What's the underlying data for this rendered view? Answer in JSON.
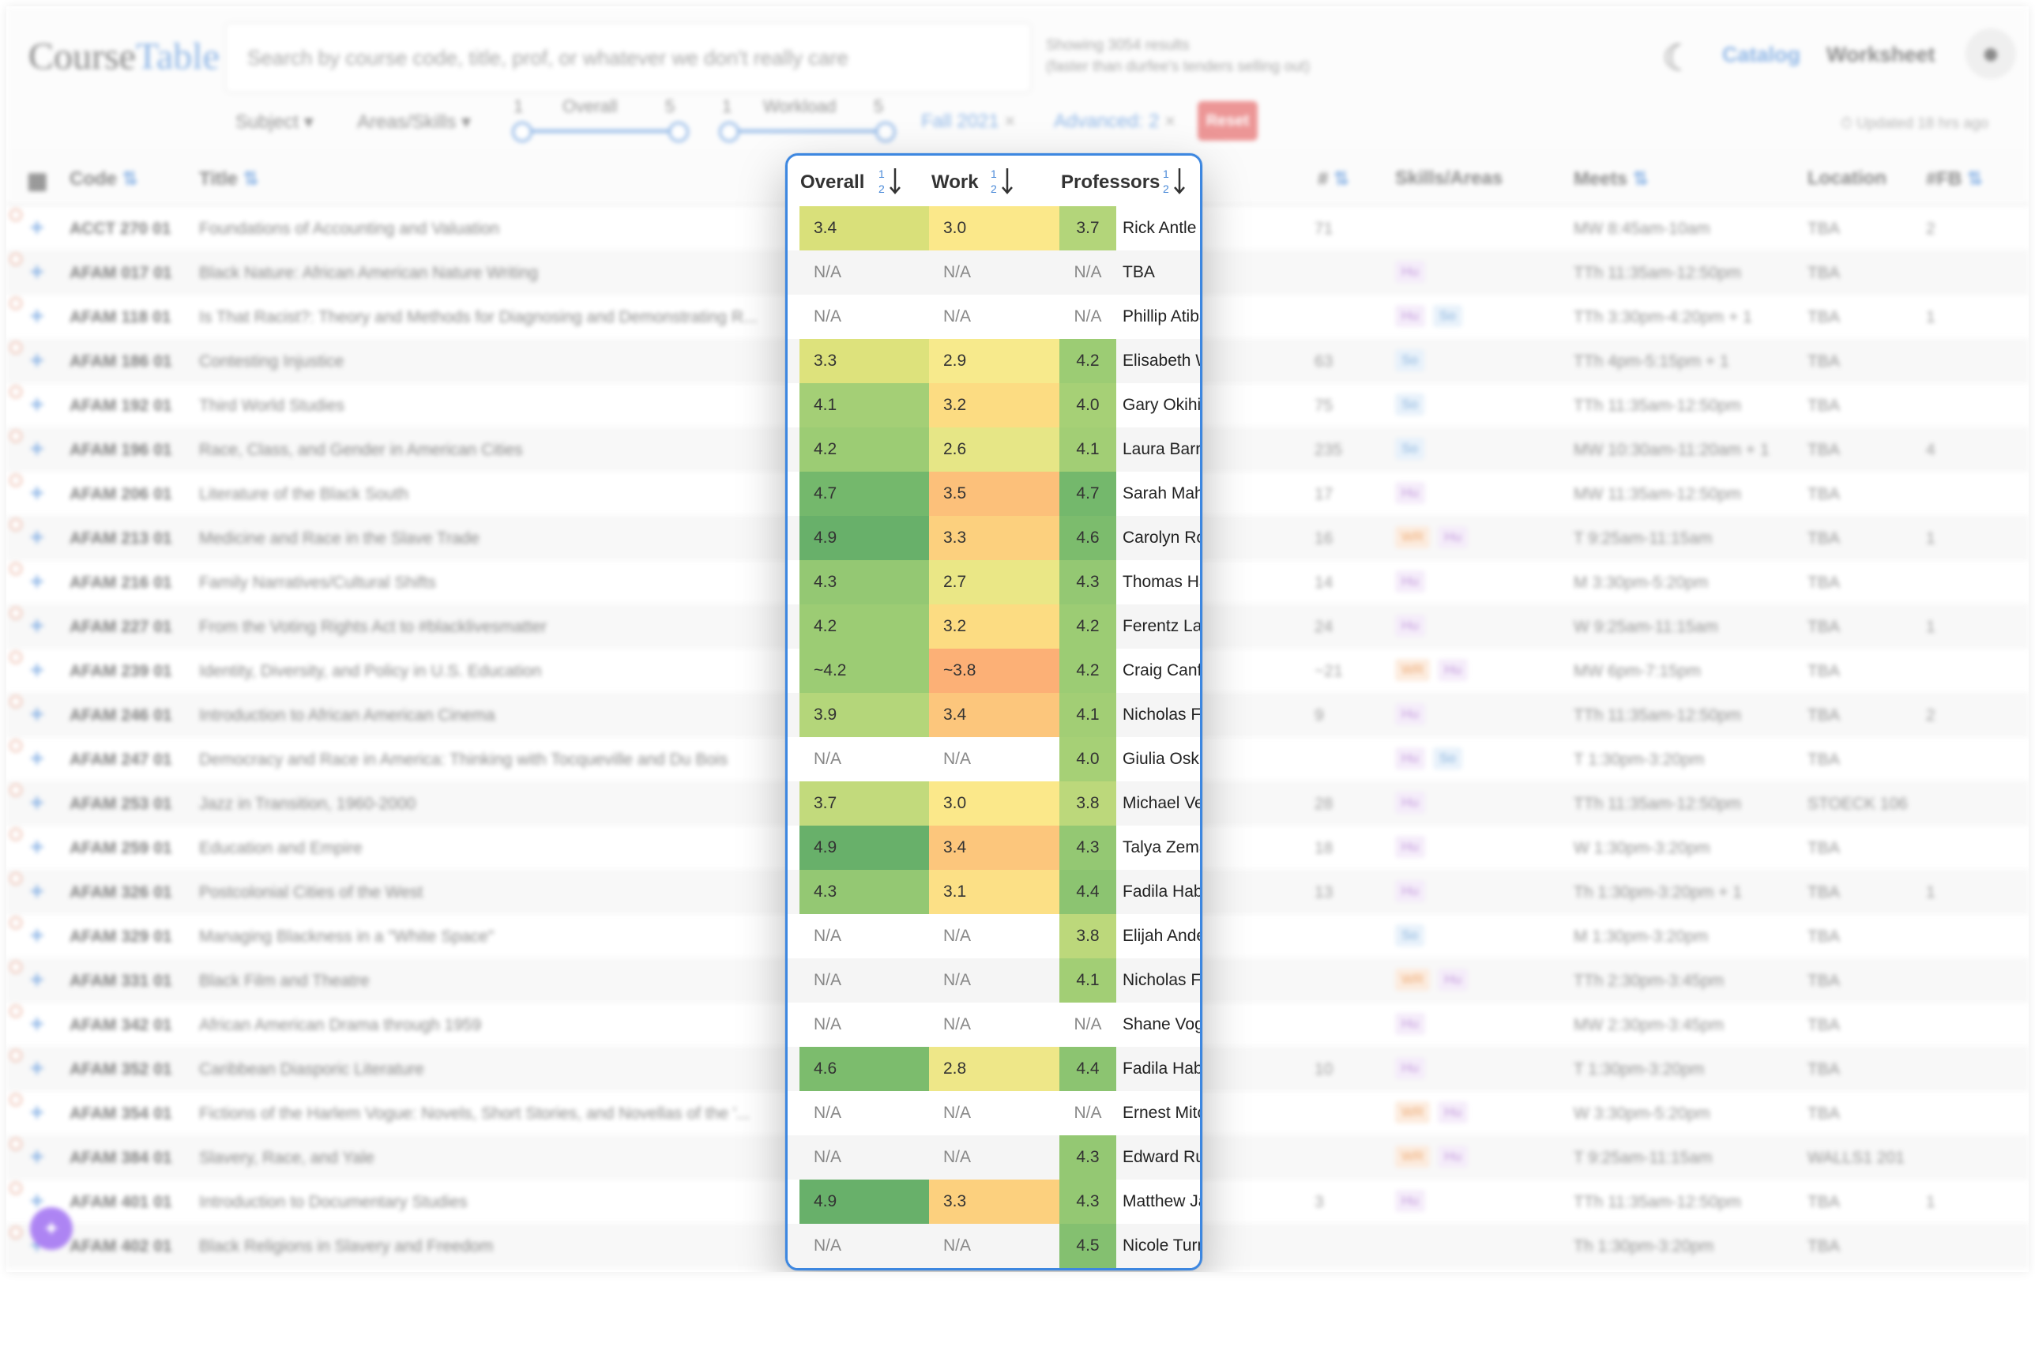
{
  "app": {
    "logo_part1": "Course",
    "logo_part2": "Table",
    "search_placeholder": "Search by course code, title, prof, or whatever we don't really care",
    "results_line1": "Showing 3054 results",
    "results_line2": "(faster than durfee's tenders selling out)",
    "nav_catalog": "Catalog",
    "nav_worksheet": "Worksheet",
    "updated": "Updated 18 hrs ago",
    "colors": {
      "accent": "#4a8ad8",
      "reset": "#e25757",
      "highlight_border": "#3d87e0"
    }
  },
  "filters": {
    "subject": "Subject",
    "areas": "Areas/Skills",
    "overall_label": "Overall",
    "workload_label": "Workload",
    "slider_min": "1",
    "slider_max": "5",
    "chip_term": "Fall 2021",
    "chip_advanced": "Advanced: 2",
    "chip_remove": "×",
    "reset": "Reset"
  },
  "columns": {
    "code": "Code",
    "title": "Title",
    "overall": "Overall",
    "work": "Work",
    "professors": "Professors",
    "enrollment": "#",
    "skills": "Skills/Areas",
    "meets": "Meets",
    "location": "Location",
    "fb": "#FB"
  },
  "rows": [
    {
      "code": "ACCT 270 01",
      "title": "Foundations of Accounting and Valuation",
      "overall": "3.4",
      "work": "3.0",
      "prof_rating": "3.7",
      "prof": "Rick Antle",
      "enroll": "71",
      "tags": [],
      "meets": "MW 8:45am-10am",
      "loc": "TBA",
      "fb": "2",
      "oc": "#d9e07a",
      "wc": "#fbe88a",
      "pc": "#b3d57a"
    },
    {
      "code": "AFAM 017 01",
      "title": "Black Nature: African American Nature Writing",
      "overall": "N/A",
      "work": "N/A",
      "prof_rating": "N/A",
      "prof": "TBA",
      "enroll": "",
      "tags": [
        "Hu"
      ],
      "meets": "TTh 11:35am-12:50pm",
      "loc": "TBA",
      "fb": "",
      "oc": "",
      "wc": "",
      "pc": ""
    },
    {
      "code": "AFAM 118 01",
      "title": "Is That Racist?: Theory and Methods for Diagnosing and Demonstrating R...",
      "overall": "N/A",
      "work": "N/A",
      "prof_rating": "N/A",
      "prof": "Phillip Atiba Goff",
      "enroll": "",
      "tags": [
        "Hu",
        "So"
      ],
      "meets": "TTh 3:30pm-4:20pm + 1",
      "loc": "TBA",
      "fb": "1",
      "oc": "",
      "wc": "",
      "pc": ""
    },
    {
      "code": "AFAM 186 01",
      "title": "Contesting Injustice",
      "overall": "3.3",
      "work": "2.9",
      "prof_rating": "4.2",
      "prof": "Elisabeth Wood",
      "enroll": "63",
      "tags": [
        "So"
      ],
      "meets": "TTh 4pm-5:15pm + 1",
      "loc": "TBA",
      "fb": "",
      "oc": "#dde27c",
      "wc": "#f7ea8c",
      "pc": "#9ccc74"
    },
    {
      "code": "AFAM 192 01",
      "title": "Third World Studies",
      "overall": "4.1",
      "work": "3.2",
      "prof_rating": "4.0",
      "prof": "Gary Okihiro",
      "enroll": "75",
      "tags": [
        "So"
      ],
      "meets": "TTh 11:35am-12:50pm",
      "loc": "TBA",
      "fb": "",
      "oc": "#a4cf76",
      "wc": "#fcdc82",
      "pc": "#a6d076"
    },
    {
      "code": "AFAM 196 01",
      "title": "Race, Class, and Gender in American Cities",
      "overall": "4.2",
      "work": "2.6",
      "prof_rating": "4.1",
      "prof": "Laura Barraclough",
      "enroll": "235",
      "tags": [
        "So"
      ],
      "meets": "MW 10:30am-11:20am + 1",
      "loc": "TBA",
      "fb": "4",
      "oc": "#9ccc74",
      "wc": "#e6e686",
      "pc": "#a2ce75"
    },
    {
      "code": "AFAM 206 01",
      "title": "Literature of the Black South",
      "overall": "4.7",
      "work": "3.5",
      "prof_rating": "4.7",
      "prof": "Sarah Mahurin",
      "enroll": "17",
      "tags": [
        "Hu"
      ],
      "meets": "MW 11:35am-12:50pm",
      "loc": "TBA",
      "fb": "",
      "oc": "#74b86c",
      "wc": "#fcc07a",
      "pc": "#74b86c"
    },
    {
      "code": "AFAM 213 01",
      "title": "Medicine and Race in the Slave Trade",
      "overall": "4.9",
      "work": "3.3",
      "prof_rating": "4.6",
      "prof": "Carolyn Roberts",
      "enroll": "16",
      "tags": [
        "WR",
        "Hu"
      ],
      "meets": "T 9:25am-11:15am",
      "loc": "TBA",
      "fb": "1",
      "oc": "#68b06a",
      "wc": "#fcd07e",
      "pc": "#7cbc6d"
    },
    {
      "code": "AFAM 216 01",
      "title": "Family Narratives/Cultural Shifts",
      "overall": "4.3",
      "work": "2.7",
      "prof_rating": "4.3",
      "prof": "Thomas Harris",
      "enroll": "14",
      "tags": [
        "Hu"
      ],
      "meets": "M 3:30pm-5:20pm",
      "loc": "TBA",
      "fb": "",
      "oc": "#94c873",
      "wc": "#eae786",
      "pc": "#94c873"
    },
    {
      "code": "AFAM 227 01",
      "title": "From the Voting Rights Act to #blacklivesmatter",
      "overall": "4.2",
      "work": "3.2",
      "prof_rating": "4.2",
      "prof": "Ferentz Lafargue",
      "enroll": "24",
      "tags": [
        "Hu"
      ],
      "meets": "W 9:25am-11:15am",
      "loc": "TBA",
      "fb": "1",
      "oc": "#9ccc74",
      "wc": "#fcdc82",
      "pc": "#9ccc74"
    },
    {
      "code": "AFAM 239 01",
      "title": "Identity, Diversity, and Policy in U.S. Education",
      "overall": "~4.2",
      "work": "~3.8",
      "prof_rating": "4.2",
      "prof": "Craig Canfield",
      "enroll": "~21",
      "tags": [
        "WR",
        "Hu"
      ],
      "meets": "MW 6pm-7:15pm",
      "loc": "TBA",
      "fb": "",
      "oc": "#9ccc74",
      "wc": "#fcb076",
      "pc": "#9ccc74"
    },
    {
      "code": "AFAM 246 01",
      "title": "Introduction to African American Cinema",
      "overall": "3.9",
      "work": "3.4",
      "prof_rating": "4.1",
      "prof": "Nicholas Forster",
      "enroll": "9",
      "tags": [
        "Hu"
      ],
      "meets": "TTh 11:35am-12:50pm",
      "loc": "TBA",
      "fb": "2",
      "oc": "#b4d67a",
      "wc": "#fcc67c",
      "pc": "#a2ce75"
    },
    {
      "code": "AFAM 247 01",
      "title": "Democracy and Race in America: Thinking with Tocqueville and Du Bois",
      "overall": "N/A",
      "work": "N/A",
      "prof_rating": "4.0",
      "prof": "Giulia Oskian + Vatsal...",
      "enroll": "",
      "tags": [
        "Hu",
        "So"
      ],
      "meets": "T 1:30pm-3:20pm",
      "loc": "TBA",
      "fb": "",
      "oc": "",
      "wc": "",
      "pc": "#a6d076"
    },
    {
      "code": "AFAM 253 01",
      "title": "Jazz in Transition, 1960-2000",
      "overall": "3.7",
      "work": "3.0",
      "prof_rating": "3.8",
      "prof": "Michael Veal",
      "enroll": "28",
      "tags": [
        "Hu"
      ],
      "meets": "TTh 11:35am-12:50pm",
      "loc": "STOECK 106",
      "fb": "",
      "oc": "#c2da7c",
      "wc": "#fbe88a",
      "pc": "#bcd87b"
    },
    {
      "code": "AFAM 259 01",
      "title": "Education and Empire",
      "overall": "4.9",
      "work": "3.4",
      "prof_rating": "4.3",
      "prof": "Talya Zemach-Bersin",
      "enroll": "18",
      "tags": [
        "Hu"
      ],
      "meets": "W 1:30pm-3:20pm",
      "loc": "TBA",
      "fb": "",
      "oc": "#68b06a",
      "wc": "#fcc67c",
      "pc": "#94c873"
    },
    {
      "code": "AFAM 326 01",
      "title": "Postcolonial Cities of the West",
      "overall": "4.3",
      "work": "3.1",
      "prof_rating": "4.4",
      "prof": "Fadila Habchi",
      "enroll": "13",
      "tags": [
        "Hu"
      ],
      "meets": "Th 1:30pm-3:20pm + 1",
      "loc": "TBA",
      "fb": "1",
      "oc": "#94c873",
      "wc": "#fce086",
      "pc": "#8cc471"
    },
    {
      "code": "AFAM 329 01",
      "title": "Managing Blackness in a \"White Space\"",
      "overall": "N/A",
      "work": "N/A",
      "prof_rating": "3.8",
      "prof": "Elijah Anderson",
      "enroll": "",
      "tags": [
        "So"
      ],
      "meets": "M 1:30pm-3:20pm",
      "loc": "TBA",
      "fb": "",
      "oc": "",
      "wc": "",
      "pc": "#bcd87b"
    },
    {
      "code": "AFAM 331 01",
      "title": "Black Film and Theatre",
      "overall": "N/A",
      "work": "N/A",
      "prof_rating": "4.1",
      "prof": "Nicholas Forster",
      "enroll": "",
      "tags": [
        "WR",
        "Hu"
      ],
      "meets": "TTh 2:30pm-3:45pm",
      "loc": "TBA",
      "fb": "",
      "oc": "",
      "wc": "",
      "pc": "#a2ce75"
    },
    {
      "code": "AFAM 342 01",
      "title": "African American Drama through 1959",
      "overall": "N/A",
      "work": "N/A",
      "prof_rating": "N/A",
      "prof": "Shane Vogel",
      "enroll": "",
      "tags": [
        "Hu"
      ],
      "meets": "MW 2:30pm-3:45pm",
      "loc": "TBA",
      "fb": "",
      "oc": "",
      "wc": "",
      "pc": ""
    },
    {
      "code": "AFAM 352 01",
      "title": "Caribbean Diasporic Literature",
      "overall": "4.6",
      "work": "2.8",
      "prof_rating": "4.4",
      "prof": "Fadila Habchi",
      "enroll": "10",
      "tags": [
        "Hu"
      ],
      "meets": "T 1:30pm-3:20pm",
      "loc": "TBA",
      "fb": "",
      "oc": "#7cbc6d",
      "wc": "#eee788",
      "pc": "#8cc471"
    },
    {
      "code": "AFAM 354 01",
      "title": "Fictions of the Harlem Vogue: Novels, Short Stories, and Novellas of the '...",
      "overall": "N/A",
      "work": "N/A",
      "prof_rating": "N/A",
      "prof": "Ernest Mitchell",
      "enroll": "",
      "tags": [
        "WR",
        "Hu"
      ],
      "meets": "W 3:30pm-5:20pm",
      "loc": "TBA",
      "fb": "",
      "oc": "",
      "wc": "",
      "pc": ""
    },
    {
      "code": "AFAM 384 01",
      "title": "Slavery, Race, and Yale",
      "overall": "N/A",
      "work": "N/A",
      "prof_rating": "4.3",
      "prof": "Edward Rugemer + Cr...",
      "enroll": "",
      "tags": [
        "WR",
        "Hu"
      ],
      "meets": "T 9:25am-11:15am",
      "loc": "WALLS1 201",
      "fb": "",
      "oc": "",
      "wc": "",
      "pc": "#94c873"
    },
    {
      "code": "AFAM 401 01",
      "title": "Introduction to Documentary Studies",
      "overall": "4.9",
      "work": "3.3",
      "prof_rating": "4.3",
      "prof": "Matthew Jacobson",
      "enroll": "3",
      "tags": [
        "Hu"
      ],
      "meets": "TTh 11:35am-12:50pm",
      "loc": "TBA",
      "fb": "1",
      "oc": "#68b06a",
      "wc": "#fcd07e",
      "pc": "#94c873"
    },
    {
      "code": "AFAM 402 01",
      "title": "Black Religions in Slavery and Freedom",
      "overall": "N/A",
      "work": "N/A",
      "prof_rating": "4.5",
      "prof": "Nicole Turner",
      "enroll": "",
      "tags": [],
      "meets": "Th 1:30pm-3:20pm",
      "loc": "TBA",
      "fb": "",
      "oc": "",
      "wc": "",
      "pc": "#84c070"
    }
  ]
}
